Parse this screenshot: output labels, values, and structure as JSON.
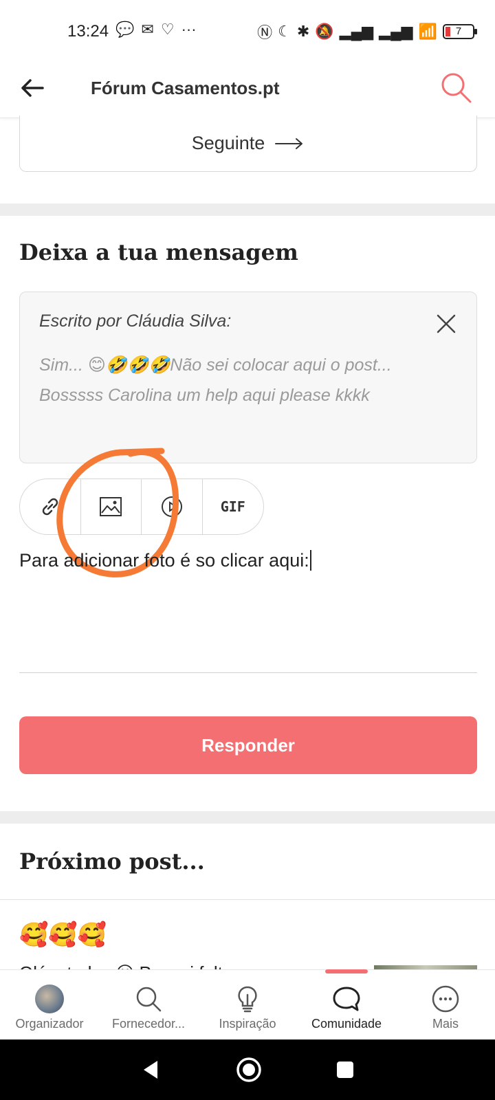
{
  "status_bar": {
    "time": "13:24",
    "battery": "7"
  },
  "header": {
    "title": "Fórum Casamentos.pt"
  },
  "pagination": {
    "next_label": "Seguinte"
  },
  "compose": {
    "section_title": "Deixa a tua mensagem",
    "quote_author": "Escrito por Cláudia Silva:",
    "quote_text": "Sim... 😊🤣🤣🤣Não sei colocar aqui o post... Bosssss Carolina um help aqui please kkkk",
    "toolbar": {
      "gif_label": "GIF"
    },
    "message_value": "Para adicionar foto é so clicar aqui:",
    "reply_label": "Responder"
  },
  "next_post": {
    "section_title": "Próximo post...",
    "emojis": "🥰🥰🥰",
    "preview": "Olá a todas 😀 Pensei faltar..."
  },
  "bottom_nav": {
    "items": [
      {
        "label": "Organizador"
      },
      {
        "label": "Fornecedor..."
      },
      {
        "label": "Inspiração"
      },
      {
        "label": "Comunidade"
      },
      {
        "label": "Mais"
      }
    ]
  },
  "colors": {
    "accent": "#f46f72",
    "annotation": "#f47a35"
  }
}
